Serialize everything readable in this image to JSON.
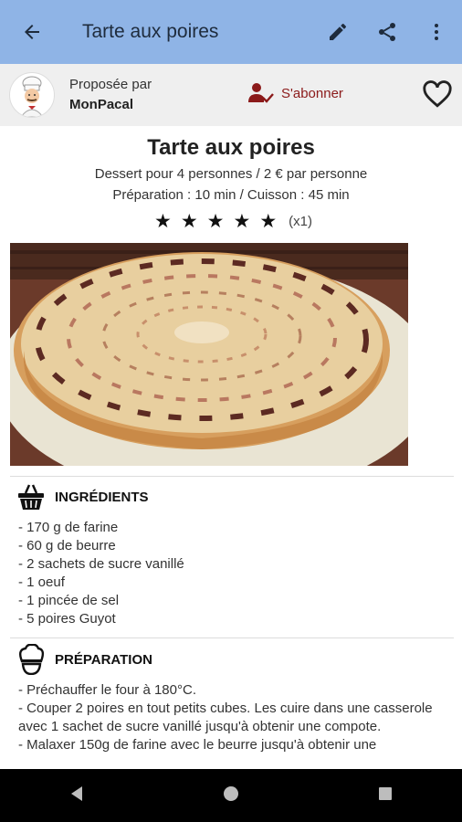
{
  "appbar": {
    "title": "Tarte aux poires"
  },
  "author": {
    "proposed_label": "Proposée par",
    "name": "MonPacal",
    "subscribe_label": "S'abonner"
  },
  "recipe": {
    "title": "Tarte aux poires",
    "meta1": "Dessert pour 4 personnes / 2 € par personne",
    "meta2": "Préparation : 10 min / Cuisson : 45 min",
    "stars": 5,
    "rating_count": "(x1)"
  },
  "ingredients": {
    "heading": "INGRÉDIENTS",
    "items": [
      "- 170 g de farine",
      "- 60 g de beurre",
      "- 2 sachets de sucre vanillé",
      "- 1 oeuf",
      "- 1 pincée de sel",
      "- 5 poires Guyot"
    ]
  },
  "preparation": {
    "heading": "PRÉPARATION",
    "steps": [
      "- Préchauffer le four à 180°C.",
      "- Couper 2 poires en tout petits cubes. Les cuire dans une casserole avec 1 sachet de sucre vanillé jusqu'à obtenir une compote.",
      "- Malaxer 150g de farine avec le beurre jusqu'à obtenir une"
    ]
  },
  "colors": {
    "appbar": "#8fb4e6",
    "accent": "#8b1a1a",
    "navbar": "#000000"
  }
}
